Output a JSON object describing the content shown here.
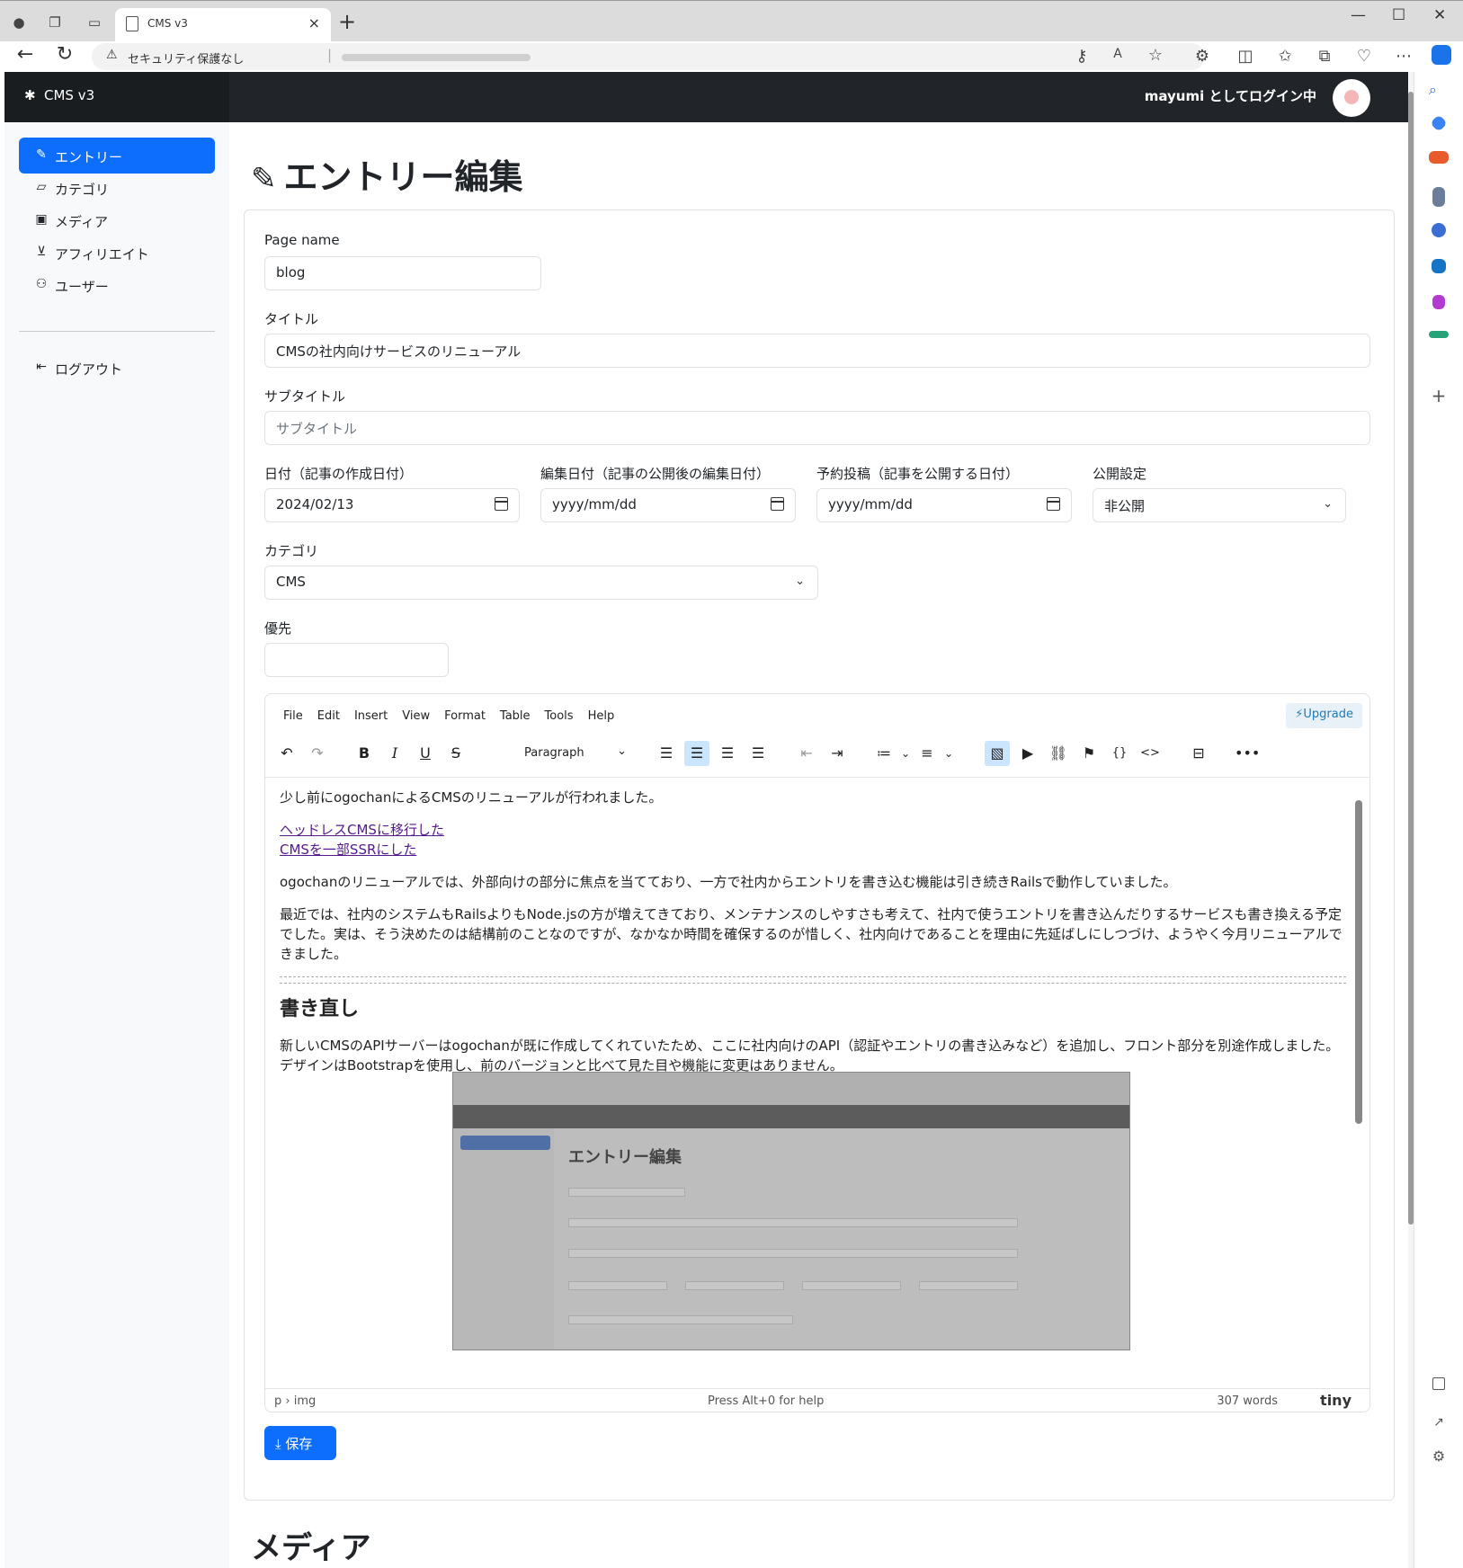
{
  "browser": {
    "tab_title": "CMS v3",
    "security_text": "セキュリティ保護なし",
    "tab_close": "×",
    "new_tab": "+",
    "window_min": "—",
    "window_max": "☐",
    "window_close": "✕"
  },
  "header": {
    "brand": "CMS v3",
    "login_as": "mayumi としてログイン中"
  },
  "sidebar": {
    "items": [
      {
        "label": "エントリー",
        "icon": "pencil-icon"
      },
      {
        "label": "カテゴリ",
        "icon": "folder-icon"
      },
      {
        "label": "メディア",
        "icon": "image-icon"
      },
      {
        "label": "アフィリエイト",
        "icon": "cart-icon"
      },
      {
        "label": "ユーザー",
        "icon": "users-icon"
      }
    ],
    "logout": "ログアウト"
  },
  "page": {
    "title": "エントリー編集",
    "media_heading": "メディア"
  },
  "form": {
    "page_name": {
      "label": "Page name",
      "value": "blog"
    },
    "title": {
      "label": "タイトル",
      "value": "CMSの社内向けサービスのリニューアル"
    },
    "subtitle": {
      "label": "サブタイトル",
      "placeholder": "サブタイトル"
    },
    "date": {
      "label": "日付（記事の作成日付）",
      "value": "2024/02/13"
    },
    "edit_date": {
      "label": "編集日付（記事の公開後の編集日付）",
      "placeholder": "yyyy/mm/dd"
    },
    "scheduled": {
      "label": "予約投稿（記事を公開する日付）",
      "placeholder": "yyyy/mm/dd"
    },
    "visibility": {
      "label": "公開設定",
      "value": "非公開"
    },
    "category": {
      "label": "カテゴリ",
      "value": "CMS"
    },
    "priority": {
      "label": "優先",
      "value": ""
    }
  },
  "editor": {
    "menu": [
      "File",
      "Edit",
      "Insert",
      "View",
      "Format",
      "Table",
      "Tools",
      "Help"
    ],
    "upgrade": "Upgrade",
    "block_format": "Paragraph",
    "content": {
      "p1": "少し前にogochanによるCMSのリニューアルが行われました。",
      "link1": "ヘッドレスCMSに移行した",
      "link2": "CMSを一部SSRにした",
      "p2": "ogochanのリニューアルでは、外部向けの部分に焦点を当てており、一方で社内からエントリを書き込む機能は引き続きRailsで動作していました。",
      "p3": "最近では、社内のシステムもRailsよりもNode.jsの方が増えてきており、メンテナンスのしやすさも考えて、社内で使うエントリを書き込んだりするサービスも書き換える予定でした。実は、そう決めたのは結構前のことなのですが、なかなか時間を確保するのが惜しく、社内向けであることを理由に先延ばしにしつづけ、ようやく今月リニューアルできました。",
      "h2": "書き直し",
      "p4": "新しいCMSのAPIサーバーはogochanが既に作成してくれていたため、ここに社内向けのAPI（認証やエントリの書き込みなど）を追加し、フロント部分を別途作成しました。デザインはBootstrapを使用し、前のバージョンと比べて見た目や機能に変更はありません。"
    },
    "embedded_image": {
      "title": "エントリー編集"
    },
    "status": {
      "path": "p › img",
      "help": "Press Alt+0 for help",
      "words": "307 words",
      "brand": "tiny"
    }
  },
  "save_button": "保存"
}
